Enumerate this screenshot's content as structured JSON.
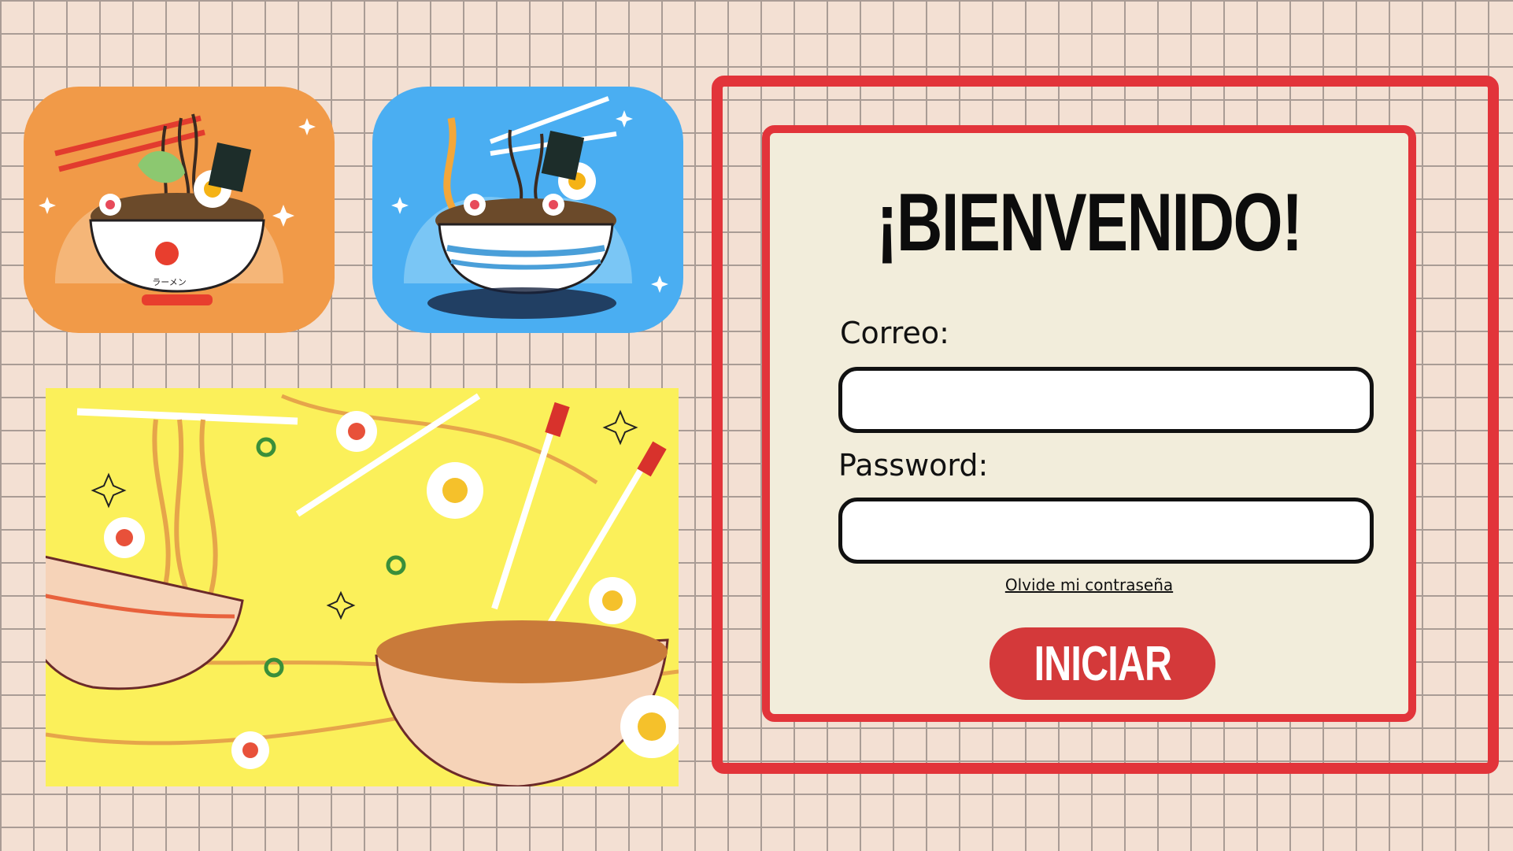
{
  "theme": {
    "background": "#f3e0d3",
    "accent_red": "#e2343a",
    "card_bg": "#f2eddb",
    "button_bg": "#d4393a",
    "orange_tile": "#f19a48",
    "blue_tile": "#4aaef2",
    "banner_bg": "#fbf05a"
  },
  "illustrations": {
    "orange_tile": {
      "icon": "ramen-bowl-illustration",
      "bowl_text": "ラーメン"
    },
    "blue_tile": {
      "icon": "ramen-bowl-tempura-illustration"
    },
    "banner": {
      "icon": "ramen-noodles-pattern-illustration"
    }
  },
  "login": {
    "title": "¡BIENVENIDO!",
    "email_label": "Correo:",
    "email_value": "",
    "email_placeholder": "",
    "password_label": "Password:",
    "password_value": "",
    "password_placeholder": "",
    "forgot_link": "Olvide mi contraseña",
    "submit_label": "INICIAR"
  }
}
